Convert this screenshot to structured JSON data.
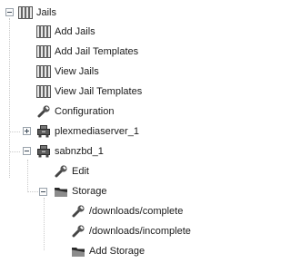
{
  "tree": {
    "root": {
      "label": "Jails",
      "icon": "jail-bars-icon",
      "expanded": true
    },
    "add_jails": {
      "label": "Add Jails",
      "icon": "jail-bars-icon"
    },
    "add_jail_templates": {
      "label": "Add Jail Templates",
      "icon": "jail-bars-icon"
    },
    "view_jails": {
      "label": "View Jails",
      "icon": "jail-bars-icon"
    },
    "view_jail_templates": {
      "label": "View Jail Templates",
      "icon": "jail-bars-icon"
    },
    "configuration": {
      "label": "Configuration",
      "icon": "wrench-icon"
    },
    "plexmediaserver": {
      "label": "plexmediaserver_1",
      "icon": "server-icon",
      "expanded": false
    },
    "sabnzbd": {
      "label": "sabnzbd_1",
      "icon": "server-icon",
      "expanded": true
    },
    "edit": {
      "label": "Edit",
      "icon": "wrench-icon"
    },
    "storage": {
      "label": "Storage",
      "icon": "storage-icon",
      "expanded": true
    },
    "downloads_complete": {
      "label": "/downloads/complete",
      "icon": "wrench-icon"
    },
    "downloads_incomplete": {
      "label": "/downloads/incomplete",
      "icon": "wrench-icon"
    },
    "add_storage": {
      "label": "Add Storage",
      "icon": "storage-icon"
    }
  }
}
